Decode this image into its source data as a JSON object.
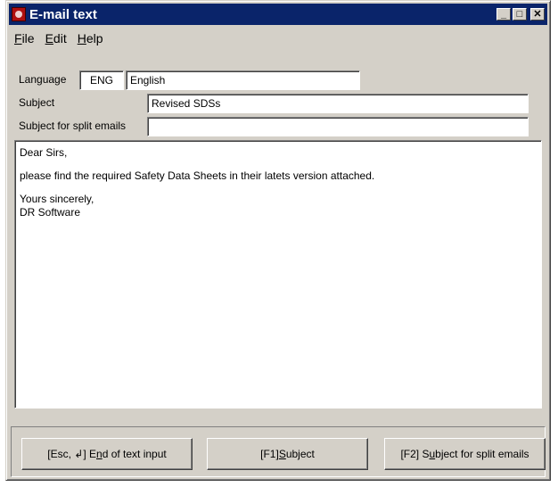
{
  "window": {
    "title": "E-mail text"
  },
  "titlebar_buttons": {
    "minimize": "_",
    "maximize": "□",
    "close": "✕"
  },
  "menu": [
    {
      "pre": "",
      "key": "F",
      "post": "ile"
    },
    {
      "pre": "",
      "key": "E",
      "post": "dit"
    },
    {
      "pre": "",
      "key": "H",
      "post": "elp"
    }
  ],
  "form": {
    "language_label": "Language",
    "language_code": "ENG",
    "language_name": "English",
    "subject_label": "Subject",
    "subject_value": "Revised SDSs",
    "split_subject_label": "Subject for split emails",
    "split_subject_value": ""
  },
  "body_text": {
    "greeting": "Dear Sirs,",
    "message": "please find the required Safety Data Sheets in their latets version attached.",
    "closing": "Yours sincerely,",
    "signature": "DR Software"
  },
  "buttons": {
    "end_input": {
      "pre": "[Esc, ↲] E",
      "key": "n",
      "post": "d of text input"
    },
    "subject": {
      "pre": "[F1] ",
      "key": "S",
      "post": "ubject"
    },
    "split_subject": {
      "pre": "[F2] S",
      "key": "u",
      "post": "bject for split emails"
    }
  }
}
